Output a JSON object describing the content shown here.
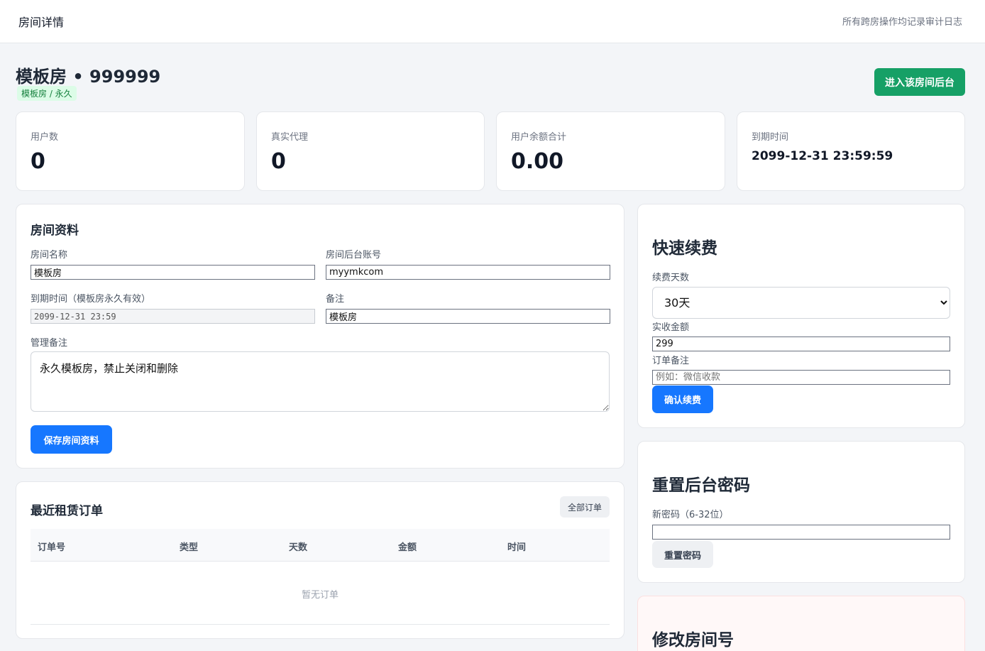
{
  "header": {
    "title": "房间详情",
    "note": "所有跨房操作均记录审计日志"
  },
  "room": {
    "title": "模板房 • 999999",
    "tag": "模板房 / 永久",
    "enter_button": "进入该房间后台"
  },
  "stats": [
    {
      "label": "用户数",
      "value": "0"
    },
    {
      "label": "真实代理",
      "value": "0"
    },
    {
      "label": "用户余额合计",
      "value": "0.00"
    },
    {
      "label": "到期时间",
      "value": "2099-12-31 23:59:59"
    }
  ],
  "profile": {
    "title": "房间资料",
    "name_label": "房间名称",
    "name_value": "模板房",
    "account_label": "房间后台账号",
    "account_value": "myymkcom",
    "expire_label": "到期时间（模板房永久有效）",
    "expire_value": "2099-12-31 23:59",
    "remark_label": "备注",
    "remark_value": "模板房",
    "admin_note_label": "管理备注",
    "admin_note_value": "永久模板房，禁止关闭和删除",
    "save_button": "保存房间资料"
  },
  "orders": {
    "title": "最近租赁订单",
    "all_button": "全部订单",
    "columns": [
      "订单号",
      "类型",
      "天数",
      "金额",
      "时间"
    ],
    "empty_text": "暂无订单"
  },
  "renew": {
    "title": "快速续费",
    "days_label": "续费天数",
    "days_value": "30天",
    "amount_label": "实收金额",
    "amount_value": "299",
    "note_label": "订单备注",
    "note_placeholder": "例如：微信收款",
    "confirm_button": "确认续费"
  },
  "reset_password": {
    "title": "重置后台密码",
    "new_label": "新密码（6-32位）",
    "button": "重置密码"
  },
  "change_number": {
    "title": "修改房间号"
  },
  "colors": {
    "primary": "#1677ff",
    "success": "#16a066",
    "background": "#f3f5f8"
  }
}
